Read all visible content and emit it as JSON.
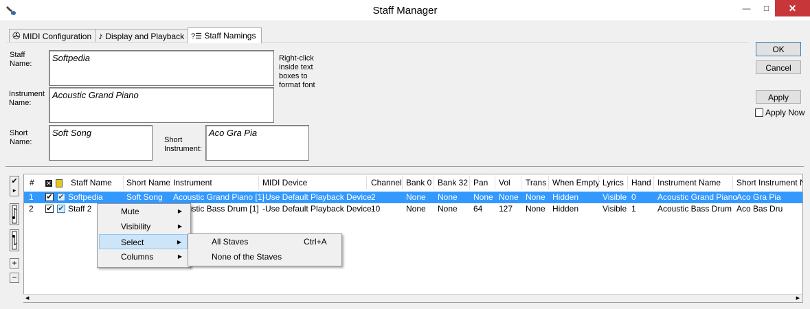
{
  "window": {
    "title": "Staff Manager",
    "app_icon": "music-tool-icon",
    "minimize_glyph": "—",
    "maximize_glyph": "□",
    "close_glyph": "✕"
  },
  "tabs": [
    {
      "label": "MIDI Configuration",
      "icon": "film-reel-icon",
      "glyph": "✇"
    },
    {
      "label": "Display and Playback",
      "icon": "music-notes-icon",
      "glyph": "♪"
    },
    {
      "label": "Staff Namings",
      "icon": "question-list-icon",
      "glyph": "?☰"
    }
  ],
  "form": {
    "staff_name_label": "Staff Name:",
    "staff_name_value": "Softpedia",
    "instrument_name_label": "Instrument Name:",
    "instrument_name_value": "Acoustic Grand Piano",
    "short_name_label": "Short Name:",
    "short_name_value": "Soft Song",
    "short_instrument_label": "Short Instrument:",
    "short_instrument_value": "Aco Gra Pia",
    "hint": "Right-click inside text boxes to format font"
  },
  "buttons": {
    "ok": "OK",
    "cancel": "Cancel",
    "apply": "Apply",
    "apply_now": "Apply Now"
  },
  "side_tools": {
    "check_glyph": "✔",
    "expand_glyph": "▸",
    "plus_glyph": "+",
    "minus_glyph": "−"
  },
  "table": {
    "columns": [
      "#",
      "",
      "",
      "Staff Name",
      "Short Name",
      "Instrument",
      "MIDI Device",
      "Channel",
      "Bank 0",
      "Bank 32",
      "Pan",
      "Vol",
      "Trans",
      "When Empty",
      "Lyrics",
      "Hand",
      "Instrument Name",
      "Short Instrument Na"
    ],
    "rows": [
      {
        "num": "1",
        "staff_name": "Softpedia",
        "short_name": "Soft Song",
        "instrument": "Acoustic Grand Piano [1]",
        "midi_device": "-Use Default Playback Device-",
        "channel": "2",
        "bank0": "None",
        "bank32": "None",
        "pan": "None",
        "vol": "None",
        "trans": "None",
        "when_empty": "Hidden",
        "lyrics": "Visible",
        "hand": "0",
        "instrument_name": "Acoustic Grand Piano",
        "short_instrument": "Aco Gra Pia"
      },
      {
        "num": "2",
        "staff_name": "Staff 2",
        "short_name": "",
        "instrument": "Acoustic Bass Drum [1]",
        "midi_device": "-Use Default Playback Device-",
        "channel": "10",
        "bank0": "None",
        "bank32": "None",
        "pan": "64",
        "vol": "127",
        "trans": "None",
        "when_empty": "Hidden",
        "lyrics": "Visible",
        "hand": "1",
        "instrument_name": "Acoustic Bass Drum",
        "short_instrument": "Aco Bas Dru"
      }
    ]
  },
  "context_menu": {
    "items": [
      "Mute",
      "Visibility",
      "Select",
      "Columns"
    ],
    "submenu": [
      {
        "label": "All Staves",
        "shortcut": "Ctrl+A"
      },
      {
        "label": "None of the Staves",
        "shortcut": ""
      }
    ]
  },
  "colors": {
    "selection": "#3399ff",
    "close_button": "#c7373a",
    "menu_highlight": "#cde5f7"
  }
}
